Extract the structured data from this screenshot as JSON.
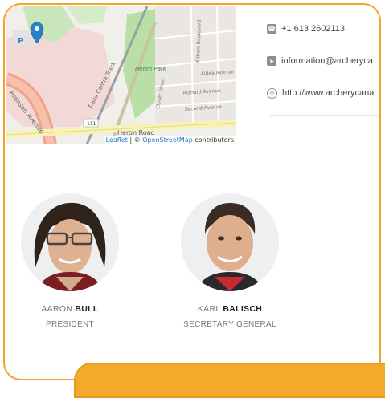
{
  "map": {
    "labels": {
      "road_heron": "Heron Road",
      "park": "Heron Park",
      "bronson": "Bronson Avenue",
      "dazu": "Dazu Centre Track",
      "richard": "Richard Avenue",
      "second": "Second Avenue",
      "aldea": "Aldea Avenue",
      "kilborn": "Kilborn Boulevard",
      "clover": "Clover Street",
      "route": "111",
      "parking": "P"
    },
    "attribution_leaflet": "Leaflet",
    "attribution_sep": " | © ",
    "attribution_osm": "OpenStreetMap",
    "attribution_suffix": " contributors"
  },
  "contact": {
    "phone": "+1 613 2602113",
    "email": "information@archeryca",
    "website": "http://www.archerycana"
  },
  "people": [
    {
      "first": "AARON",
      "last": "BULL",
      "role": "PRESIDENT"
    },
    {
      "first": "KARL",
      "last": "BALISCH",
      "role": "SECRETARY GENERAL"
    }
  ],
  "colors": {
    "accent": "#f3a92b",
    "text": "#444444",
    "icon": "#8a8f96"
  }
}
